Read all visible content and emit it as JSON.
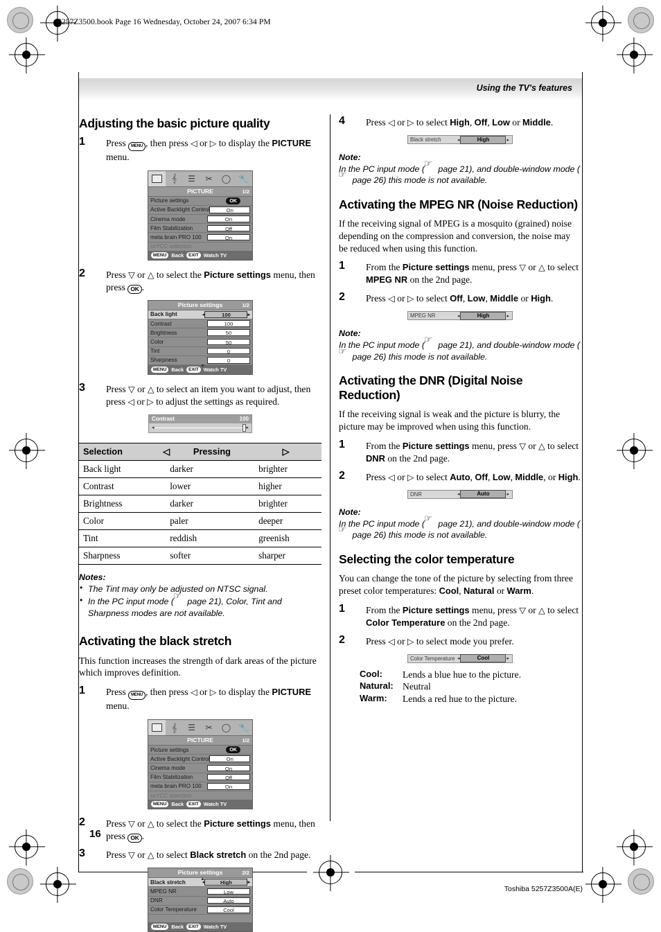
{
  "file_line": "5257Z3500.book  Page 16  Wednesday, October 24, 2007  6:34 PM",
  "header": {
    "title": "Using the TV's features"
  },
  "page_number": "16",
  "footer_id": "Toshiba 5257Z3500A(E)",
  "left_column": {
    "section1": {
      "heading": "Adjusting the basic picture quality",
      "step1": {
        "num": "1",
        "pre": "Press",
        "key": "MENU",
        "mid": ", then press",
        "arrow_l": "◁",
        "or": "or",
        "arrow_r": "▷",
        "post": "to display the",
        "bold": "PICTURE",
        "tail": "menu."
      },
      "step2": {
        "num": "2",
        "pre": "Press",
        "arrow_d": "▽",
        "or": "or",
        "arrow_u": "△",
        "post": "to select the",
        "bold": "Picture settings",
        "tail": "menu, then press",
        "key": "OK",
        "end": "."
      },
      "step3": {
        "num": "3",
        "text_a": "Press",
        "arrow_d": "▽",
        "or": "or",
        "arrow_u": "△",
        "text_b": "to select an item you want to adjust, then press",
        "arrow_l": "◁",
        "or2": "or",
        "arrow_r": "▷",
        "text_c": "to adjust the settings as required."
      }
    },
    "picture_menu": {
      "title": "PICTURE",
      "page": "1/2",
      "rows": [
        {
          "label": "Picture settings",
          "value": "OK",
          "type": "ok"
        },
        {
          "label": "Active Backlight Control",
          "value": "On",
          "type": "val"
        },
        {
          "label": "Cinema mode",
          "value": "On",
          "type": "val"
        },
        {
          "label": "Film Stabilization",
          "value": "Off",
          "type": "val"
        },
        {
          "label": "meta brain PRO 100",
          "value": "On",
          "type": "val"
        },
        {
          "label": "xvYCC selection",
          "value": "",
          "type": "dim"
        }
      ],
      "foot": {
        "k1": "MENU",
        "l1": "Back",
        "k2": "EXIT",
        "l2": "Watch TV"
      }
    },
    "picture_settings_menu": {
      "title": "Picture settings",
      "page": "1/2",
      "rows": [
        {
          "label": "Back light",
          "value": "100",
          "selected": true
        },
        {
          "label": "Contrast",
          "value": "100",
          "selected": false
        },
        {
          "label": "Brightness",
          "value": "50",
          "selected": false
        },
        {
          "label": "Color",
          "value": "50",
          "selected": false
        },
        {
          "label": "Tint",
          "value": "0",
          "selected": false
        },
        {
          "label": "Sharpness",
          "value": "0",
          "selected": false
        }
      ],
      "foot": {
        "k1": "MENU",
        "l1": "Back",
        "k2": "EXIT",
        "l2": "Watch TV"
      }
    },
    "contrast_bar": {
      "label": "Contrast",
      "value": "100"
    },
    "table": {
      "headers": [
        "Selection",
        "◁",
        "Pressing",
        "▷"
      ],
      "rows": [
        [
          "Back light",
          "darker",
          "brighter"
        ],
        [
          "Contrast",
          "lower",
          "higher"
        ],
        [
          "Brightness",
          "darker",
          "brighter"
        ],
        [
          "Color",
          "paler",
          "deeper"
        ],
        [
          "Tint",
          "reddish",
          "greenish"
        ],
        [
          "Sharpness",
          "softer",
          "sharper"
        ]
      ]
    },
    "notes": {
      "title": "Notes:",
      "items": [
        {
          "pre": "The ",
          "b1": "Tint",
          "mid": " may only be adjusted on NTSC signal.",
          "b2": "",
          "post": ""
        },
        {
          "pre": "In the PC input mode (",
          "ref": " page 21), ",
          "b1": "Color",
          "sep1": ", ",
          "b2": "Tint",
          "mid2": " and ",
          "b3": "Sharpness",
          "post": " modes are not available."
        }
      ]
    },
    "section2": {
      "heading": "Activating the black stretch",
      "intro": "This function increases the strength of dark areas of the picture which improves definition.",
      "step1": {
        "num": "1",
        "pre": "Press",
        "key": "MENU",
        "mid": ", then press",
        "arrow_l": "◁",
        "or": "or",
        "arrow_r": "▷",
        "post": "to display the",
        "bold": "PICTURE",
        "tail": "menu."
      },
      "step2": {
        "num": "2",
        "pre": "Press",
        "arrow_d": "▽",
        "or": "or",
        "arrow_u": "△",
        "post": "to select the",
        "bold": "Picture settings",
        "tail": "menu, then press",
        "key": "OK",
        "end": "."
      },
      "step3": {
        "num": "3",
        "pre": "Press",
        "arrow_d": "▽",
        "or": "or",
        "arrow_u": "△",
        "post": "to select",
        "bold": "Black stretch",
        "tail": "on the 2nd page."
      }
    },
    "picture_settings_menu2": {
      "title": "Picture settings",
      "page": "2/2",
      "rows": [
        {
          "label": "Black stretch",
          "value": "High",
          "selected": true
        },
        {
          "label": "MPEG NR",
          "value": "Low",
          "selected": false
        },
        {
          "label": "DNR",
          "value": "Auto",
          "selected": false
        },
        {
          "label": "Color Temperature",
          "value": "Cool",
          "selected": false
        }
      ],
      "foot": {
        "k1": "MENU",
        "l1": "Back",
        "k2": "EXIT",
        "l2": "Watch TV"
      }
    }
  },
  "right_column": {
    "step4": {
      "num": "4",
      "pre": "Press",
      "arrow_l": "◁",
      "or": "or",
      "arrow_r": "▷",
      "post": "to select",
      "b1": "High",
      "s1": ", ",
      "b2": "Off",
      "s2": ", ",
      "b3": "Low",
      "s3": " or ",
      "b4": "Middle",
      "end": "."
    },
    "black_stretch_bar": {
      "label": "Black stretch",
      "value": "High"
    },
    "note1": {
      "title": "Note:",
      "line1_a": "In the PC input mode (",
      "line1_b": " page 21), and double-window mode",
      "line2_a": "(",
      "line2_b": " page 26) this mode is not available."
    },
    "section_mpeg": {
      "heading": "Activating the MPEG NR (Noise Reduction)",
      "intro": "If the receiving signal of MPEG is a mosquito (grained) noise depending on the compression and conversion, the noise may be reduced when using this function.",
      "step1": {
        "num": "1",
        "pre": "From the",
        "b1": "Picture settings",
        "mid": "menu, press",
        "arrow_d": "▽",
        "or": "or",
        "arrow_u": "△",
        "post": "to select",
        "b2": "MPEG NR",
        "tail": "on the 2nd page."
      },
      "step2": {
        "num": "2",
        "pre": "Press",
        "arrow_l": "◁",
        "or": "or",
        "arrow_r": "▷",
        "post": "to select",
        "b1": "Off",
        "s1": ", ",
        "b2": "Low",
        "s2": ", ",
        "b3": "Middle",
        "s3": " or ",
        "b4": "High",
        "end": "."
      }
    },
    "mpeg_bar": {
      "label": "MPEG NR",
      "value": "High"
    },
    "note2": {
      "title": "Note:",
      "line1_a": "In the PC input mode (",
      "line1_b": " page 21), and double-window mode",
      "line2_a": "(",
      "line2_b": " page 26) this mode is not available."
    },
    "section_dnr": {
      "heading": "Activating the DNR (Digital Noise Reduction)",
      "intro": "If the receiving signal is weak and the picture is blurry, the picture may be improved when using this function.",
      "step1": {
        "num": "1",
        "pre": "From the",
        "b1": "Picture settings",
        "mid": "menu, press",
        "arrow_d": "▽",
        "or": "or",
        "arrow_u": "△",
        "post": "to select",
        "b2": "DNR",
        "tail": "on the 2nd page."
      },
      "step2": {
        "num": "2",
        "pre": "Press",
        "arrow_l": "◁",
        "or": "or",
        "arrow_r": "▷",
        "post": "to select",
        "b1": "Auto",
        "s1": ", ",
        "b2": "Off",
        "s2": ", ",
        "b3": "Low",
        "s3": ", ",
        "b4": "Middle",
        "s4": ", or ",
        "b5": "High",
        "end": "."
      }
    },
    "dnr_bar": {
      "label": "DNR",
      "value": "Auto"
    },
    "note3": {
      "title": "Note:",
      "line1_a": "In the PC input mode (",
      "line1_b": " page 21), and double-window mode",
      "line2_a": "(",
      "line2_b": " page 26) this mode is not available."
    },
    "section_color": {
      "heading": "Selecting the color temperature",
      "intro_a": "You can change the tone of the picture by selecting from three preset color temperatures: ",
      "b1": "Cool",
      "sep1": ", ",
      "b2": "Natural",
      "sep2": " or ",
      "b3": "Warm",
      "intro_end": ".",
      "step1": {
        "num": "1",
        "pre": "From the",
        "b1": "Picture settings",
        "mid": "menu, press",
        "arrow_d": "▽",
        "or": "or",
        "arrow_u": "△",
        "post": "to select",
        "b2": "Color Temperature",
        "tail": "on the 2nd page."
      },
      "step2": {
        "num": "2",
        "pre": "Press",
        "arrow_l": "◁",
        "or": "or",
        "arrow_r": "▷",
        "post": "to select mode you prefer."
      }
    },
    "color_bar": {
      "label": "Color Temperature",
      "value": "Cool"
    },
    "definitions": [
      {
        "term": "Cool",
        "colon": ":",
        "desc": "Lends a blue hue to the picture."
      },
      {
        "term": "Natural",
        "colon": ":",
        "desc": "Neutral"
      },
      {
        "term": "Warm",
        "colon": ":",
        "desc": "Lends a red hue to the picture."
      }
    ]
  }
}
